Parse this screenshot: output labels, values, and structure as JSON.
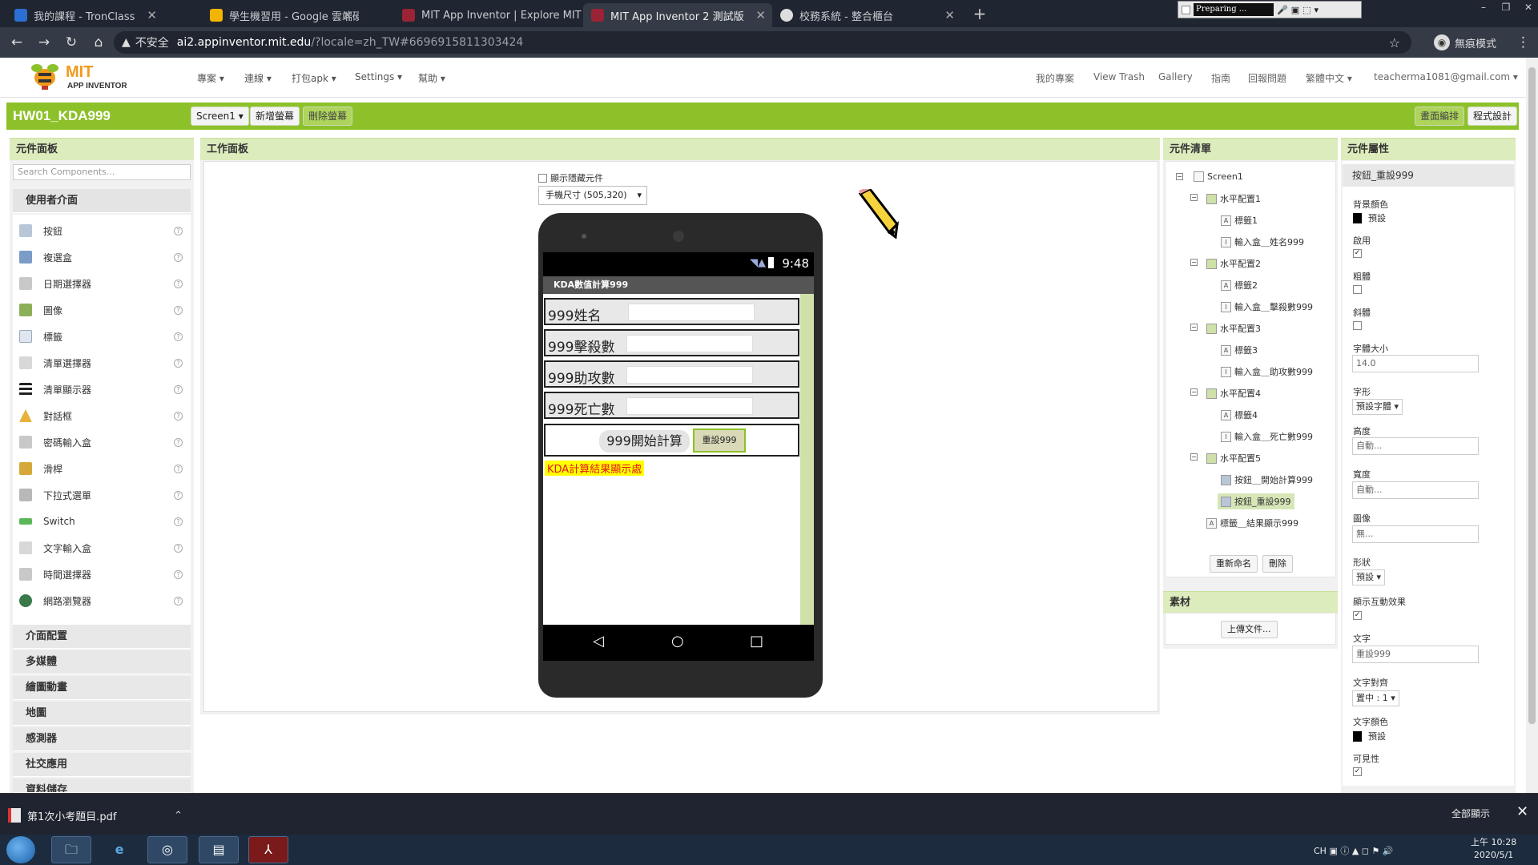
{
  "browser": {
    "tabs": [
      {
        "title": "我的課程 - TronClass",
        "color": "#2a6fd1"
      },
      {
        "title": "學生機習用 - Google 雲端硬碟",
        "color": "#f2b400"
      },
      {
        "title": "MIT App Inventor | Explore MIT",
        "color": "#9b2335"
      },
      {
        "title": "MIT App Inventor 2 測試版",
        "color": "#9b2335"
      },
      {
        "title": "校務系統 - 整合櫃台",
        "color": "#dddddd"
      }
    ],
    "preparing": "Preparing ...",
    "insecure_label": "不安全",
    "url_host": "ai2.appinventor.mit.edu",
    "url_path": "/?locale=zh_TW#6696915811303424",
    "incognito_label": "無痕模式"
  },
  "app": {
    "logo_mit": "MIT",
    "logo_text": "APP INVENTOR",
    "menus": [
      "專案 ▾",
      "連線 ▾",
      "打包apk ▾",
      "Settings ▾",
      "幫助 ▾"
    ],
    "right_links": [
      "我的專案",
      "View Trash",
      "Gallery",
      "指南",
      "回報問題",
      "繁體中文 ▾",
      "teacherma1081@gmail.com ▾"
    ]
  },
  "project": {
    "name": "HW01_KDA999",
    "screen_select": "Screen1 ▾",
    "add_screen": "新增螢幕",
    "remove_screen": "刪除螢幕",
    "designer_btn": "畫面編排",
    "blocks_btn": "程式設計"
  },
  "palette": {
    "header": "元件面板",
    "search_placeholder": "Search Components...",
    "section": "使用者介面",
    "items": [
      {
        "label": "按鈕",
        "icon": "button-icon",
        "color": "#b8c6d8"
      },
      {
        "label": "複選盒",
        "icon": "checkbox-icon",
        "color": "#7a9cc7"
      },
      {
        "label": "日期選擇器",
        "icon": "datepicker-icon",
        "color": "#c8c8c8"
      },
      {
        "label": "圖像",
        "icon": "image-icon",
        "color": "#8cb05a"
      },
      {
        "label": "標籤",
        "icon": "label-icon",
        "color": "#dfe6ef"
      },
      {
        "label": "清單選擇器",
        "icon": "listpicker-icon",
        "color": "#d8d8d8"
      },
      {
        "label": "清單顯示器",
        "icon": "listview-icon",
        "color": "#222222"
      },
      {
        "label": "對話框",
        "icon": "notifier-icon",
        "color": "#e8b23a"
      },
      {
        "label": "密碼輸入盒",
        "icon": "password-icon",
        "color": "#c8c8c8"
      },
      {
        "label": "滑桿",
        "icon": "slider-icon",
        "color": "#d6a83a"
      },
      {
        "label": "下拉式選單",
        "icon": "spinner-icon",
        "color": "#b8b8b8"
      },
      {
        "label": "Switch",
        "icon": "switch-icon",
        "color": "#5ab85a"
      },
      {
        "label": "文字輸入盒",
        "icon": "textbox-icon",
        "color": "#d8d8d8"
      },
      {
        "label": "時間選擇器",
        "icon": "timepicker-icon",
        "color": "#c8c8c8"
      },
      {
        "label": "網路瀏覽器",
        "icon": "webviewer-icon",
        "color": "#3a7a4a"
      }
    ],
    "categories": [
      "介面配置",
      "多媒體",
      "繪圖動畫",
      "地圖",
      "感測器",
      "社交應用",
      "資料儲存"
    ]
  },
  "viewer": {
    "header": "工作面板",
    "show_hidden": "顯示隱藏元件",
    "size_select": "手機尺寸 (505,320)",
    "clock": "9:48",
    "app_title": "KDA數值計算999",
    "rows": [
      "999姓名",
      "999擊殺數",
      "999助攻數",
      "999死亡數"
    ],
    "start_button": "999開始計算",
    "reset_button": "重設999",
    "result_label": "KDA計算結果顯示處"
  },
  "components": {
    "header": "元件清單",
    "tree": [
      {
        "label": "Screen1",
        "level": 0,
        "toggle": "⊟"
      },
      {
        "label": "水平配置1",
        "level": 1,
        "toggle": "⊟"
      },
      {
        "label": "標籤1",
        "level": 2
      },
      {
        "label": "輸入盒＿姓名999",
        "level": 2
      },
      {
        "label": "水平配置2",
        "level": 1,
        "toggle": "⊟"
      },
      {
        "label": "標籤2",
        "level": 2
      },
      {
        "label": "輸入盒＿擊殺數999",
        "level": 2
      },
      {
        "label": "水平配置3",
        "level": 1,
        "toggle": "⊟"
      },
      {
        "label": "標籤3",
        "level": 2
      },
      {
        "label": "輸入盒＿助攻數999",
        "level": 2
      },
      {
        "label": "水平配置4",
        "level": 1,
        "toggle": "⊟"
      },
      {
        "label": "標籤4",
        "level": 2
      },
      {
        "label": "輸入盒＿死亡數999",
        "level": 2
      },
      {
        "label": "水平配置5",
        "level": 1,
        "toggle": "⊟"
      },
      {
        "label": "按鈕＿開始計算999",
        "level": 2
      },
      {
        "label": "按鈕_重設999",
        "level": 2,
        "selected": true
      },
      {
        "label": "標籤＿結果顯示999",
        "level": 1
      }
    ],
    "rename": "重新命名",
    "delete": "刪除",
    "media_header": "素材",
    "upload": "上傳文件..."
  },
  "properties": {
    "header": "元件屬性",
    "component": "按鈕_重設999",
    "bg_label": "背景顏色",
    "bg_value": "預設",
    "enabled_label": "啟用",
    "bold_label": "粗體",
    "italic_label": "斜體",
    "fontsize_label": "字體大小",
    "fontsize_value": "14.0",
    "font_label": "字形",
    "font_value": "預設字體 ▾",
    "height_label": "高度",
    "height_value": "自動...",
    "width_label": "寬度",
    "width_value": "自動...",
    "image_label": "圖像",
    "image_value": "無...",
    "shape_label": "形狀",
    "shape_value": "預設 ▾",
    "feedback_label": "顯示互動效果",
    "text_label": "文字",
    "text_value": "重設999",
    "align_label": "文字對齊",
    "align_value": "置中 : 1 ▾",
    "textcolor_label": "文字顏色",
    "textcolor_value": "預設",
    "visible_label": "可見性"
  },
  "download": {
    "file": "第1次小考題目.pdf",
    "show_all": "全部顯示"
  },
  "taskbar": {
    "lang": "CH",
    "time": "上午 10:28",
    "date": "2020/5/1"
  }
}
